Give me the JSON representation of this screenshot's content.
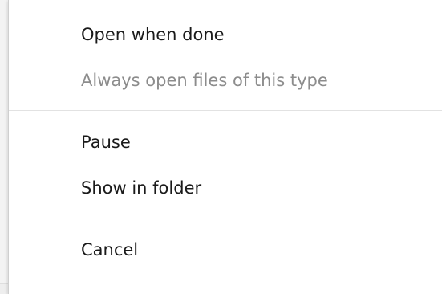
{
  "menu": {
    "sections": [
      {
        "items": [
          {
            "label": "Open when done",
            "enabled": true
          },
          {
            "label": "Always open files of this type",
            "enabled": false
          }
        ]
      },
      {
        "items": [
          {
            "label": "Pause",
            "enabled": true
          },
          {
            "label": "Show in folder",
            "enabled": true
          }
        ]
      },
      {
        "items": [
          {
            "label": "Cancel",
            "enabled": true
          }
        ]
      }
    ]
  }
}
